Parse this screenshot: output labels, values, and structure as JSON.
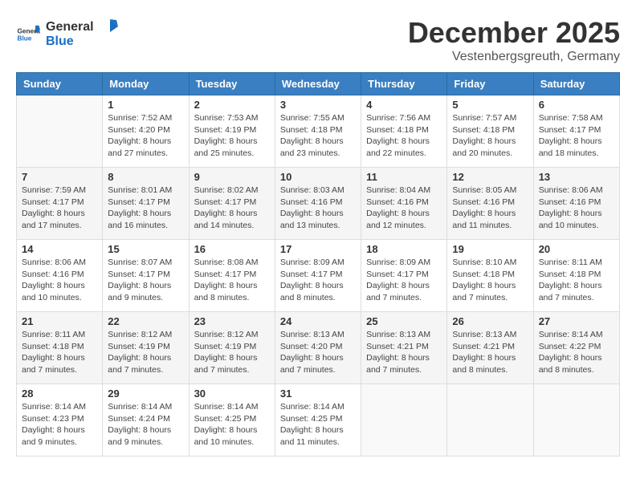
{
  "header": {
    "logo_general": "General",
    "logo_blue": "Blue",
    "month": "December 2025",
    "location": "Vestenbergsgreuth, Germany"
  },
  "weekdays": [
    "Sunday",
    "Monday",
    "Tuesday",
    "Wednesday",
    "Thursday",
    "Friday",
    "Saturday"
  ],
  "weeks": [
    [
      {
        "num": "",
        "info": ""
      },
      {
        "num": "1",
        "info": "Sunrise: 7:52 AM\nSunset: 4:20 PM\nDaylight: 8 hours\nand 27 minutes."
      },
      {
        "num": "2",
        "info": "Sunrise: 7:53 AM\nSunset: 4:19 PM\nDaylight: 8 hours\nand 25 minutes."
      },
      {
        "num": "3",
        "info": "Sunrise: 7:55 AM\nSunset: 4:18 PM\nDaylight: 8 hours\nand 23 minutes."
      },
      {
        "num": "4",
        "info": "Sunrise: 7:56 AM\nSunset: 4:18 PM\nDaylight: 8 hours\nand 22 minutes."
      },
      {
        "num": "5",
        "info": "Sunrise: 7:57 AM\nSunset: 4:18 PM\nDaylight: 8 hours\nand 20 minutes."
      },
      {
        "num": "6",
        "info": "Sunrise: 7:58 AM\nSunset: 4:17 PM\nDaylight: 8 hours\nand 18 minutes."
      }
    ],
    [
      {
        "num": "7",
        "info": "Sunrise: 7:59 AM\nSunset: 4:17 PM\nDaylight: 8 hours\nand 17 minutes."
      },
      {
        "num": "8",
        "info": "Sunrise: 8:01 AM\nSunset: 4:17 PM\nDaylight: 8 hours\nand 16 minutes."
      },
      {
        "num": "9",
        "info": "Sunrise: 8:02 AM\nSunset: 4:17 PM\nDaylight: 8 hours\nand 14 minutes."
      },
      {
        "num": "10",
        "info": "Sunrise: 8:03 AM\nSunset: 4:16 PM\nDaylight: 8 hours\nand 13 minutes."
      },
      {
        "num": "11",
        "info": "Sunrise: 8:04 AM\nSunset: 4:16 PM\nDaylight: 8 hours\nand 12 minutes."
      },
      {
        "num": "12",
        "info": "Sunrise: 8:05 AM\nSunset: 4:16 PM\nDaylight: 8 hours\nand 11 minutes."
      },
      {
        "num": "13",
        "info": "Sunrise: 8:06 AM\nSunset: 4:16 PM\nDaylight: 8 hours\nand 10 minutes."
      }
    ],
    [
      {
        "num": "14",
        "info": "Sunrise: 8:06 AM\nSunset: 4:16 PM\nDaylight: 8 hours\nand 10 minutes."
      },
      {
        "num": "15",
        "info": "Sunrise: 8:07 AM\nSunset: 4:17 PM\nDaylight: 8 hours\nand 9 minutes."
      },
      {
        "num": "16",
        "info": "Sunrise: 8:08 AM\nSunset: 4:17 PM\nDaylight: 8 hours\nand 8 minutes."
      },
      {
        "num": "17",
        "info": "Sunrise: 8:09 AM\nSunset: 4:17 PM\nDaylight: 8 hours\nand 8 minutes."
      },
      {
        "num": "18",
        "info": "Sunrise: 8:09 AM\nSunset: 4:17 PM\nDaylight: 8 hours\nand 7 minutes."
      },
      {
        "num": "19",
        "info": "Sunrise: 8:10 AM\nSunset: 4:18 PM\nDaylight: 8 hours\nand 7 minutes."
      },
      {
        "num": "20",
        "info": "Sunrise: 8:11 AM\nSunset: 4:18 PM\nDaylight: 8 hours\nand 7 minutes."
      }
    ],
    [
      {
        "num": "21",
        "info": "Sunrise: 8:11 AM\nSunset: 4:18 PM\nDaylight: 8 hours\nand 7 minutes."
      },
      {
        "num": "22",
        "info": "Sunrise: 8:12 AM\nSunset: 4:19 PM\nDaylight: 8 hours\nand 7 minutes."
      },
      {
        "num": "23",
        "info": "Sunrise: 8:12 AM\nSunset: 4:19 PM\nDaylight: 8 hours\nand 7 minutes."
      },
      {
        "num": "24",
        "info": "Sunrise: 8:13 AM\nSunset: 4:20 PM\nDaylight: 8 hours\nand 7 minutes."
      },
      {
        "num": "25",
        "info": "Sunrise: 8:13 AM\nSunset: 4:21 PM\nDaylight: 8 hours\nand 7 minutes."
      },
      {
        "num": "26",
        "info": "Sunrise: 8:13 AM\nSunset: 4:21 PM\nDaylight: 8 hours\nand 8 minutes."
      },
      {
        "num": "27",
        "info": "Sunrise: 8:14 AM\nSunset: 4:22 PM\nDaylight: 8 hours\nand 8 minutes."
      }
    ],
    [
      {
        "num": "28",
        "info": "Sunrise: 8:14 AM\nSunset: 4:23 PM\nDaylight: 8 hours\nand 9 minutes."
      },
      {
        "num": "29",
        "info": "Sunrise: 8:14 AM\nSunset: 4:24 PM\nDaylight: 8 hours\nand 9 minutes."
      },
      {
        "num": "30",
        "info": "Sunrise: 8:14 AM\nSunset: 4:25 PM\nDaylight: 8 hours\nand 10 minutes."
      },
      {
        "num": "31",
        "info": "Sunrise: 8:14 AM\nSunset: 4:25 PM\nDaylight: 8 hours\nand 11 minutes."
      },
      {
        "num": "",
        "info": ""
      },
      {
        "num": "",
        "info": ""
      },
      {
        "num": "",
        "info": ""
      }
    ]
  ]
}
